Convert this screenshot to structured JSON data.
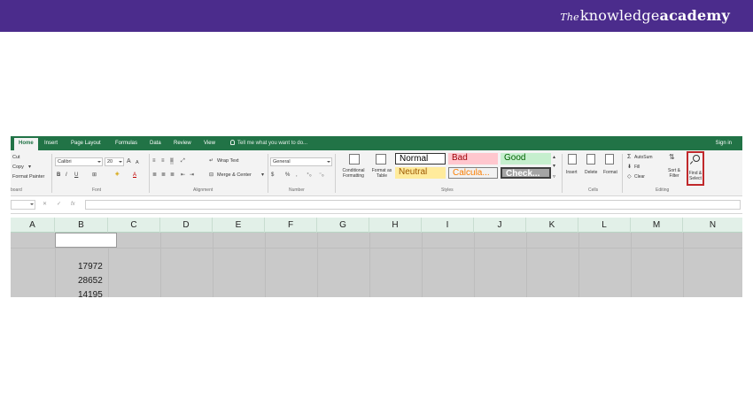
{
  "brand": {
    "prefix": "The",
    "name": "knowledge",
    "accent": "academy",
    "bg": "#4b2c8c"
  },
  "tabs": [
    "Home",
    "Insert",
    "Page Layout",
    "Formulas",
    "Data",
    "Review",
    "View"
  ],
  "tell_me": "Tell me what you want to do...",
  "sign_in": "Sign in",
  "clipboard": {
    "cut": "Cut",
    "copy": "Copy",
    "format_painter": "Format Painter",
    "label": "board"
  },
  "font": {
    "name": "Calibri",
    "size": "20",
    "grow": "A",
    "shrink": "A",
    "bold": "B",
    "italic": "I",
    "underline": "U",
    "label": "Font"
  },
  "alignment": {
    "wrap": "Wrap Text",
    "merge": "Merge & Center",
    "label": "Alignment"
  },
  "number": {
    "format": "General",
    "currency": "$",
    "percent": "%",
    "comma": ",",
    "label": "Number"
  },
  "styles": {
    "conditional": "Conditional Formatting",
    "table": "Format as Table",
    "label": "Styles",
    "items": [
      {
        "text": "Normal",
        "bg": "#ffffff",
        "color": "#000000"
      },
      {
        "text": "Bad",
        "bg": "#ffc7ce",
        "color": "#9c0006"
      },
      {
        "text": "Good",
        "bg": "#c6efce",
        "color": "#006100"
      },
      {
        "text": "Neutral",
        "bg": "#ffeb9c",
        "color": "#9c5700"
      },
      {
        "text": "Calcula...",
        "bg": "#f2f2f2",
        "color": "#fa7d00"
      },
      {
        "text": "Check...",
        "bg": "#a5a5a5",
        "color": "#ffffff"
      }
    ]
  },
  "cells_group": {
    "insert": "Insert",
    "delete": "Delete",
    "format": "Format",
    "label": "Cells"
  },
  "editing": {
    "autosum": "AutoSum",
    "fill": "Fill",
    "clear": "Clear",
    "sort": "Sort & Filter",
    "find": "Find & Select",
    "label": "Editing"
  },
  "columns": [
    "A",
    "B",
    "C",
    "D",
    "E",
    "F",
    "G",
    "H",
    "I",
    "J",
    "K",
    "L",
    "M",
    "N"
  ],
  "values": [
    "17972",
    "28652",
    "14195"
  ],
  "colors": {
    "excel_green": "#217346",
    "header_green": "#e2f0e8",
    "highlight": "#c0282b"
  }
}
